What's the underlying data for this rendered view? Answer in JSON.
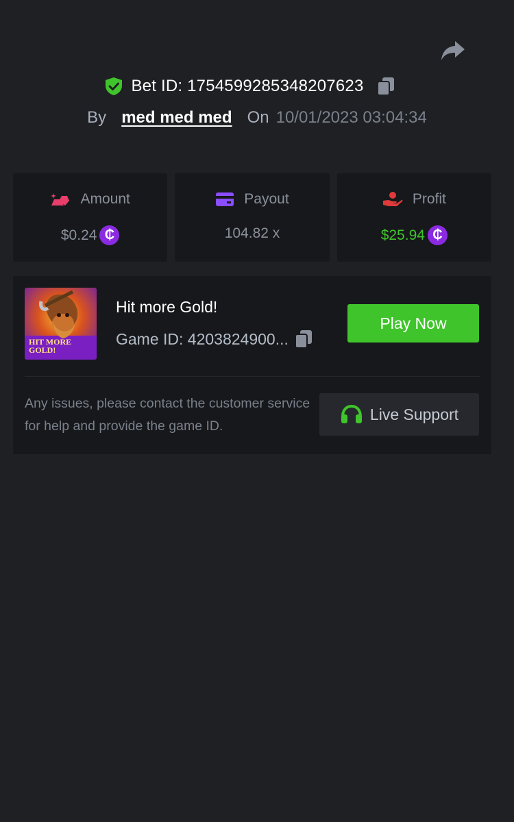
{
  "header": {
    "bet_id_text": "Bet ID: 1754599285348207623",
    "by_label": "By",
    "username": "med med med",
    "on_label": "On",
    "datetime": "10/01/2023 03:04:34"
  },
  "stats": [
    {
      "label": "Amount",
      "value": "$0.24",
      "icon": "gold-bars-icon",
      "coin_symbol": "₵",
      "color": "#8a909b"
    },
    {
      "label": "Payout",
      "value": "104.82 x",
      "icon": "card-icon",
      "color": "#8a909b"
    },
    {
      "label": "Profit",
      "value": "$25.94",
      "icon": "hand-money-icon",
      "coin_symbol": "₵",
      "color": "#3fc52b"
    }
  ],
  "game": {
    "thumbnail_text_line1": "HIT MORE",
    "thumbnail_text_line2": "GOLD!",
    "name": "Hit more Gold!",
    "game_id_text": "Game ID: 4203824900...",
    "play_button": "Play Now"
  },
  "support": {
    "help_text": "Any issues, please contact the customer service for help and provide the game ID.",
    "button_label": "Live Support"
  },
  "colors": {
    "background": "#1f2024",
    "card": "#17181b",
    "accent_green": "#3fc52b",
    "coin_purple": "#8a2be2",
    "muted_text": "#8a909b"
  }
}
